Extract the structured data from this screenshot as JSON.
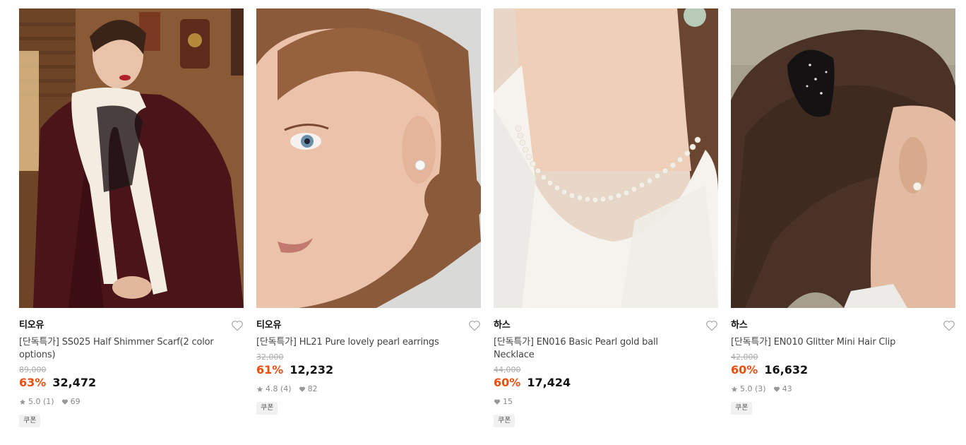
{
  "products": [
    {
      "brand": "티오유",
      "title": "[단독특가] SS025 Half Shimmer Scarf(2 color options)",
      "original_price": "89,000",
      "discount": "63%",
      "price": "32,472",
      "rating": "5.0 (1)",
      "likes": "69",
      "coupon": "쿠폰"
    },
    {
      "brand": "티오유",
      "title": "[단독특가] HL21 Pure lovely pearl earrings",
      "original_price": "32,000",
      "discount": "61%",
      "price": "12,232",
      "rating": "4.8 (4)",
      "likes": "82",
      "coupon": "쿠폰"
    },
    {
      "brand": "하스",
      "title": "[단독특가] EN016 Basic Pearl gold ball Necklace",
      "original_price": "44,000",
      "discount": "60%",
      "price": "17,424",
      "rating": "",
      "likes": "15",
      "coupon": "쿠폰"
    },
    {
      "brand": "하스",
      "title": "[단독특가] EN010 Glitter Mini Hair Clip",
      "original_price": "42,000",
      "discount": "60%",
      "price": "16,632",
      "rating": "5.0 (3)",
      "likes": "43",
      "coupon": "쿠폰"
    }
  ],
  "colors": {
    "discount": "#ee4d0c",
    "muted": "#888888"
  },
  "icons": {
    "wish": "heart-outline-icon",
    "rating": "star-icon",
    "likes": "heart-filled-icon"
  }
}
